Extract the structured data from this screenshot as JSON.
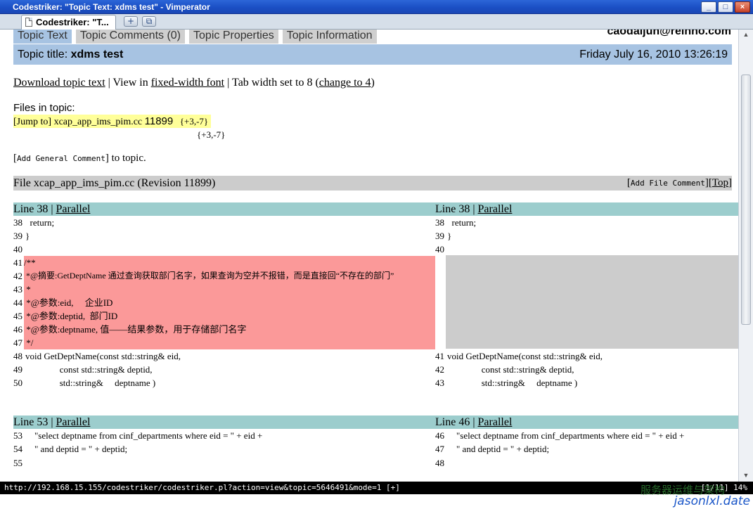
{
  "window": {
    "title": "Codestriker: \"Topic Text: xdms test\" - Vimperator",
    "buttons": [
      "_",
      "□",
      "×"
    ]
  },
  "browser": {
    "tab_label": "Codestriker: \"T...",
    "new_tab_label": "+",
    "tab_list_label": "⧉"
  },
  "page": {
    "tabs": [
      "Topic Text",
      "Topic Comments (0)",
      "Topic Properties",
      "Topic Information"
    ],
    "user": "caodaijun@reinno.com",
    "topic_title_label": "Topic title:",
    "topic_title": "xdms test",
    "date": "Friday July 16, 2010 13:26:19",
    "links": {
      "download": "Download topic text",
      "sep1": " | View in ",
      "font": "fixed-width font",
      "sep2": " | Tab width set to 8 (",
      "change": "change to 4",
      "close": ")"
    },
    "files_label": "Files in topic:",
    "file_entry": {
      "jump": "[Jump to]",
      "name": "xcap_app_ims_pim.cc",
      "revision": "11899",
      "delta": "{+3,-7}",
      "delta2": "{+3,-7}"
    },
    "general_comment": {
      "open": "[",
      "button": "Add General Comment",
      "close": "]",
      "suffix": " to topic."
    },
    "file_header": {
      "title": "File xcap_app_ims_pim.cc (Revision 11899)",
      "add_open": "[",
      "add_button": "Add File Comment",
      "add_close": "]",
      "top": "Top"
    },
    "hunks": [
      {
        "left_head": "Line 38",
        "right_head": "Line 38",
        "sep": " | ",
        "parallel": "Parallel",
        "left_lines": [
          {
            "n": "38",
            "t": "  return;"
          },
          {
            "n": "39",
            "t": "}"
          },
          {
            "n": "40",
            "t": ""
          },
          {
            "n": "41",
            "t": "/**"
          },
          {
            "n": "42",
            "t": " *@摘要:GetDeptName 通过查询获取部门名字，如果查询为空并不报错，而是直接回“不存在的部门”"
          },
          {
            "n": "43",
            "t": " *"
          },
          {
            "n": "44",
            "t": " *@参数:eid,     企业ID"
          },
          {
            "n": "45",
            "t": " *@参数:deptid,  部门ID"
          },
          {
            "n": "46",
            "t": " *@参数:deptname, 值——结果参数，用于存储部门名字"
          },
          {
            "n": "47",
            "t": " */"
          },
          {
            "n": "48",
            "t": "void GetDeptName(const std::string& eid,"
          },
          {
            "n": "49",
            "t": "               const std::string& deptid,"
          },
          {
            "n": "50",
            "t": "               std::string&     deptname )"
          }
        ],
        "right_lines": [
          {
            "n": "38",
            "t": "  return;"
          },
          {
            "n": "39",
            "t": "}"
          },
          {
            "n": "40",
            "t": ""
          },
          {
            "n": "41",
            "t": "void GetDeptName(const std::string& eid,"
          },
          {
            "n": "42",
            "t": "               const std::string& deptid,"
          },
          {
            "n": "43",
            "t": "               std::string&     deptname )"
          }
        ]
      },
      {
        "left_head": "Line 53",
        "right_head": "Line 46",
        "sep": " | ",
        "parallel": "Parallel",
        "left_lines": [
          {
            "n": "53",
            "t": "    \"select deptname from cinf_departments where eid = \" + eid +"
          },
          {
            "n": "54",
            "t": "    \" and deptid = \" + deptid;"
          },
          {
            "n": "55",
            "t": ""
          }
        ],
        "right_lines": [
          {
            "n": "46",
            "t": "    \"select deptname from cinf_departments where eid = \" + eid +"
          },
          {
            "n": "47",
            "t": "    \" and deptid = \" + deptid;"
          },
          {
            "n": "48",
            "t": ""
          }
        ]
      }
    ]
  },
  "statusbar": {
    "url": "http://192.168.15.155/codestriker/codestriker.pl?action=view&topic=5646491&mode=1 [+]",
    "position": "[1/11] 14%"
  },
  "watermarks": {
    "top": "服务器运维与架构",
    "bottom": "jasonlxl.date"
  },
  "colors": {
    "titlebar": "#1b4fc4",
    "tab_active": "#a7c3e2",
    "tab_inactive": "#cfcfcf",
    "hunk_header": "#9ccdcd",
    "removed": "#fb9999",
    "placeholder": "#cccccc",
    "file_highlight": "#ffff99"
  }
}
